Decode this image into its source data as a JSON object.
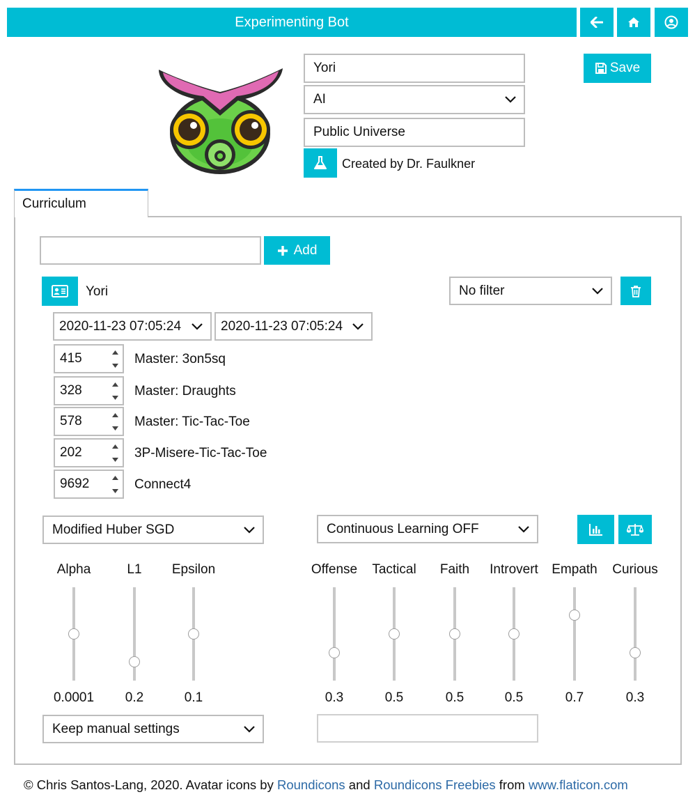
{
  "header": {
    "title": "Experimenting Bot",
    "icons": [
      "arrow-left-icon",
      "home-icon",
      "user-circle-icon"
    ]
  },
  "profile": {
    "name": "Yori",
    "type": "AI",
    "universe": "Public Universe",
    "creator": "Created by Dr. Faulkner",
    "save_label": "Save"
  },
  "tabs": [
    {
      "label": "Curriculum"
    }
  ],
  "curriculum": {
    "add_input_value": "",
    "add_label": "Add",
    "bot_name": "Yori",
    "filter": "No filter",
    "date_from": "2020-11-23 07:05:24",
    "date_to": "2020-11-23 07:05:24",
    "games": [
      {
        "value": "415",
        "label": "Master: 3on5sq"
      },
      {
        "value": "328",
        "label": "Master: Draughts"
      },
      {
        "value": "578",
        "label": "Master: Tic-Tac-Toe"
      },
      {
        "value": "202",
        "label": "3P-Misere-Tic-Tac-Toe"
      },
      {
        "value": "9692",
        "label": "Connect4"
      }
    ],
    "algorithm": "Modified Huber SGD",
    "learning_mode": "Continuous Learning OFF",
    "hyper_sliders": [
      {
        "label": "Alpha",
        "value": "0.0001",
        "level": 0.5
      },
      {
        "label": "L1",
        "value": "0.2",
        "level": 0.2
      },
      {
        "label": "Epsilon",
        "value": "0.1",
        "level": 0.5
      }
    ],
    "personality_sliders": [
      {
        "label": "Offense",
        "value": "0.3",
        "level": 0.3
      },
      {
        "label": "Tactical",
        "value": "0.5",
        "level": 0.5
      },
      {
        "label": "Faith",
        "value": "0.5",
        "level": 0.5
      },
      {
        "label": "Introvert",
        "value": "0.5",
        "level": 0.5
      },
      {
        "label": "Empath",
        "value": "0.7",
        "level": 0.7
      },
      {
        "label": "Curious",
        "value": "0.3",
        "level": 0.3
      }
    ],
    "settings_mode": "Keep manual settings",
    "notes_value": ""
  },
  "footer": {
    "prefix": "© Chris Santos-Lang, 2020. Avatar icons by ",
    "link1": "Roundicons",
    "and": " and ",
    "link2": "Roundicons Freebies",
    "from": " from ",
    "link3": "www.flaticon.com"
  },
  "colors": {
    "accent": "#00bcd4",
    "border": "#bdbdbd",
    "link": "#2d6aa6",
    "tab_top": "#2196f3"
  }
}
